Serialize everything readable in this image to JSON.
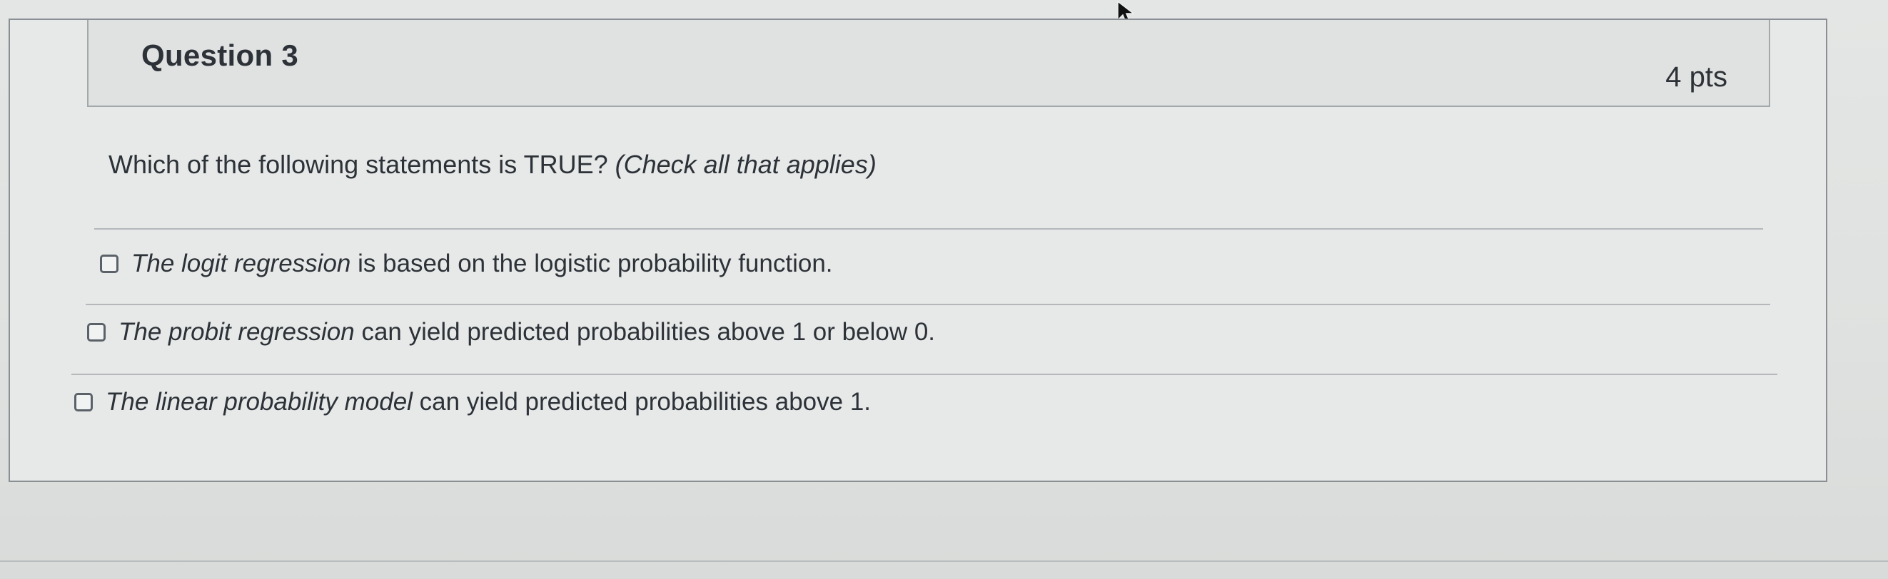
{
  "question": {
    "title": "Question 3",
    "points": "4 pts",
    "prompt_main": "Which of the following statements is TRUE? ",
    "prompt_hint": "(Check all that applies)"
  },
  "answers": [
    {
      "lead_italic": "The logit regression",
      "rest": " is based on the logistic probability function.",
      "checked": false
    },
    {
      "lead_italic": "The probit regression",
      "rest": " can yield predicted probabilities above 1 or below 0.",
      "checked": false
    },
    {
      "lead_italic": "The linear probability model",
      "rest": " can yield predicted probabilities above 1.",
      "checked": false
    }
  ],
  "icons": {
    "flag": "bookmark-flag-icon",
    "cursor": "mouse-cursor-icon"
  },
  "colors": {
    "text": "#2d3238",
    "border": "#8a8f93",
    "background": "#e4e6e5"
  }
}
